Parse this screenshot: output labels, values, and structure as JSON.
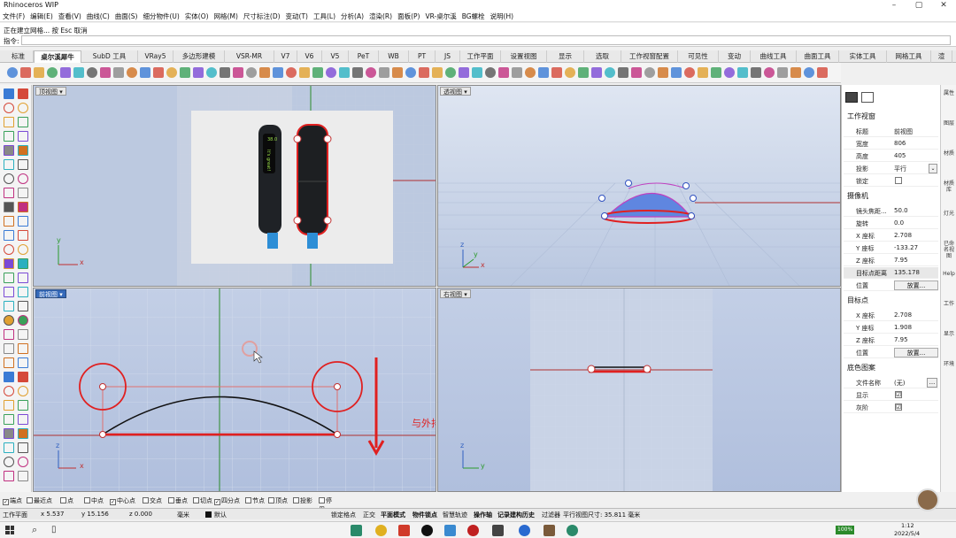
{
  "window": {
    "title": "Rhinoceros WIP",
    "min": "–",
    "max": "▢",
    "close": "✕"
  },
  "menu": [
    "文件(F)",
    "编辑(E)",
    "查看(V)",
    "曲线(C)",
    "曲面(S)",
    "细分物件(U)",
    "实体(O)",
    "网格(M)",
    "尺寸标注(D)",
    "变动(T)",
    "工具(L)",
    "分析(A)",
    "渲染(R)",
    "面板(P)",
    "VR-桌尔溪",
    "BG螺栓",
    "说明(H)"
  ],
  "command": {
    "history": "正在建立网格... 按 Esc 取消",
    "prompt": "指令:",
    "value": ""
  },
  "tabs": [
    "标准",
    "桌尔溪犀牛",
    "SubD 工具",
    "VRay5",
    "多边形建模",
    "VSR-MR",
    "V7",
    "V6",
    "V5",
    "PeT",
    "WB",
    "PT",
    "JS",
    "工作平面",
    "设置视图",
    "显示",
    "选取",
    "工作视窗配置",
    "可见性",
    "变动",
    "曲线工具",
    "曲面工具",
    "实体工具",
    "网格工具",
    "渲"
  ],
  "activeTab": 1,
  "viewports": {
    "top": "顶视图 ▾",
    "perspective": "透视图 ▾",
    "front": "前视图 ▾",
    "right": "右视图 ▾"
  },
  "axis": {
    "x": "x",
    "y": "y",
    "z": "z"
  },
  "annotation": "与外排点垂直于X轴",
  "device": {
    "screen1": "38.0",
    "screen2": "It's great!"
  },
  "panel": {
    "section1": "工作视窗",
    "rows1": [
      {
        "k": "标题",
        "v": "前视图"
      },
      {
        "k": "宽度",
        "v": "806"
      },
      {
        "k": "高度",
        "v": "405"
      },
      {
        "k": "投影",
        "v": "平行"
      },
      {
        "k": "锁定",
        "v": ""
      }
    ],
    "section2": "摄像机",
    "rows2": [
      {
        "k": "镜头焦距...",
        "v": "50.0"
      },
      {
        "k": "旋转",
        "v": "0.0"
      },
      {
        "k": "X 座标",
        "v": "2.708"
      },
      {
        "k": "Y 座标",
        "v": "-133.27"
      },
      {
        "k": "Z 座标",
        "v": "7.95"
      },
      {
        "k": "目标点距离",
        "v": "135.178"
      },
      {
        "k": "位置",
        "v": "放置..."
      }
    ],
    "section3": "目标点",
    "rows3": [
      {
        "k": "X 座标",
        "v": "2.708"
      },
      {
        "k": "Y 座标",
        "v": "1.908"
      },
      {
        "k": "Z 座标",
        "v": "7.95"
      },
      {
        "k": "位置",
        "v": "放置..."
      }
    ],
    "section4": "底色图案",
    "rows4": [
      {
        "k": "文件名称",
        "v": "(无)"
      },
      {
        "k": "显示",
        "v": "☑"
      },
      {
        "k": "灰阶",
        "v": "☑"
      }
    ],
    "more": "..."
  },
  "sidestrip": [
    "属性",
    "图层",
    "材质",
    "材质库",
    "灯光",
    "已命名视图",
    "Help",
    "工作",
    "显示",
    "环境"
  ],
  "osnap": [
    {
      "label": "端点",
      "on": true
    },
    {
      "label": "最近点",
      "on": false
    },
    {
      "label": "点",
      "on": false
    },
    {
      "label": "中点",
      "on": false
    },
    {
      "label": "中心点",
      "on": true
    },
    {
      "label": "交点",
      "on": false
    },
    {
      "label": "垂点",
      "on": false
    },
    {
      "label": "切点",
      "on": false
    },
    {
      "label": "四分点",
      "on": true
    },
    {
      "label": "节点",
      "on": false
    },
    {
      "label": "顶点",
      "on": false
    },
    {
      "label": "投影",
      "on": false
    },
    {
      "label": "停用",
      "on": false
    }
  ],
  "status": {
    "cplane": "工作平面",
    "x": "x 5.537",
    "y": "y 15.156",
    "z": "z 0.000",
    "unit": "毫米",
    "layer": "默认",
    "items": [
      "锁定格点",
      "正交",
      "平面模式",
      "物件锁点",
      "智慧轨迹",
      "操作轴",
      "记录建构历史",
      "过滤器"
    ],
    "info": "平行视图尺寸: 35.811 毫米"
  },
  "taskbar": {
    "battery": "100%",
    "time": "1:12",
    "date": "2022/5/4"
  }
}
